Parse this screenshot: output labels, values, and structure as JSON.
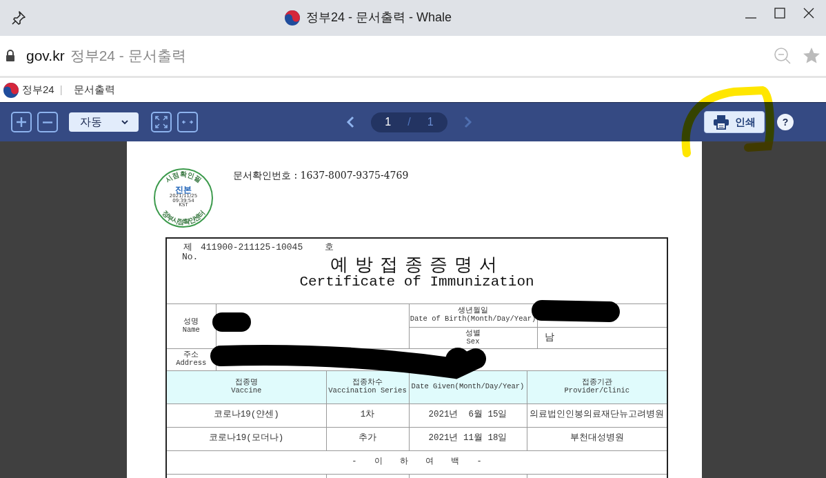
{
  "window": {
    "title": "정부24 - 문서출력 - Whale"
  },
  "address_bar": {
    "domain": "gov.kr",
    "page_title": "정부24 - 문서출력"
  },
  "site_header": {
    "brand": "정부24",
    "separator": "|",
    "section": "문서출력"
  },
  "viewer_toolbar": {
    "zoom_mode": "자동",
    "page_current": "1",
    "page_separator": "/",
    "page_total": "1",
    "prev_disabled": false,
    "next_disabled": true,
    "print_label": "인쇄",
    "help": "?"
  },
  "document": {
    "confirm_label": "문서확인번호 :",
    "confirm_number": "1637-8007-9375-4769",
    "seal": {
      "top": "시점확인필",
      "middle": "진본",
      "date": "2021/11/25",
      "time": "09:39:54",
      "zone": "KST",
      "bottom": "정부시점확인센터"
    },
    "certificate": {
      "no_prefix": "제",
      "number": "411900-211125-10045",
      "no_suffix": "호",
      "no_label": "No.",
      "title_ko": "예방접종증명서",
      "title_en": "Certificate of Immunization",
      "name_label": {
        "korean": "성명",
        "english": "Name"
      },
      "birth_label": {
        "korean": "생년월일",
        "english": "Date of Birth(Month/Day/Year)"
      },
      "sex_label": {
        "korean": "성별",
        "english": "Sex"
      },
      "sex_value": "남",
      "address_label": {
        "korean": "주소",
        "english": "Address"
      },
      "columns": [
        {
          "korean": "접종명",
          "english": "Vaccine"
        },
        {
          "korean": "접종차수",
          "english": "Vaccination Series"
        },
        {
          "english": "Date Given(Month/Day/Year)"
        },
        {
          "korean": "접종기관",
          "english": "Provider/Clinic"
        }
      ],
      "rows": [
        [
          "코로나19(얀센)",
          "1차",
          "2021년  6월 15일",
          "의료법인인봉의료재단뉴고려병원"
        ],
        [
          "코로나19(모더나)",
          "추가",
          "2021년 11월 18일",
          "부천대성병원"
        ]
      ],
      "end_note": "- 이 하 여 백 -"
    }
  }
}
